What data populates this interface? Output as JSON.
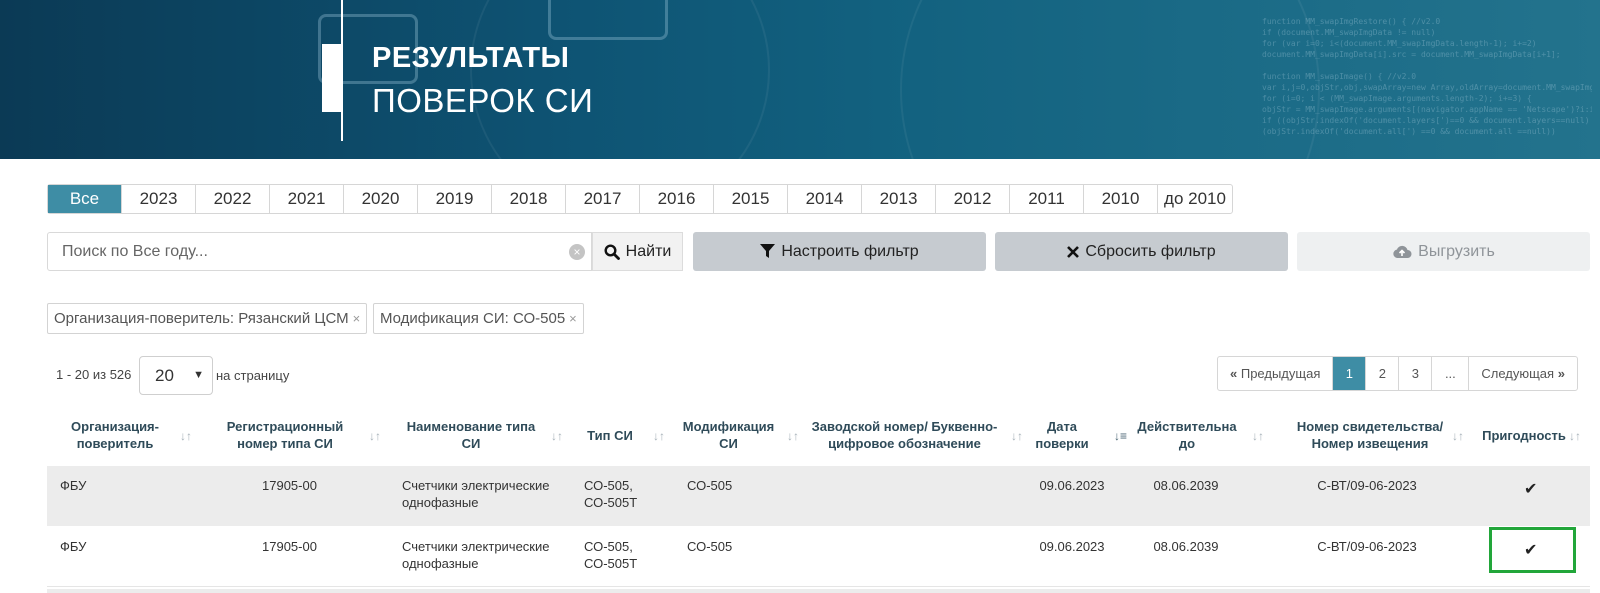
{
  "banner": {
    "title_line1": "РЕЗУЛЬТАТЫ",
    "title_line2": "ПОВЕРОК СИ",
    "code_lines": [
      "function MM_swapImgRestore() { //v2.0",
      "if (document.MM_swapImgData != null)",
      "for (var i=0; i<(document.MM_swapImgData.length-1); i+=2)",
      "document.MM_swapImgData[i].src = document.MM_swapImgData[i+1];",
      "",
      "function MM_swapImage() { //v2.0",
      "var i,j=0,objStr,obj,swapArray=new Array,oldArray=document.MM_swapImgData;",
      "for (i=0; i < (MM_swapImage.arguments.length-2); i+=3) {",
      "objStr = MM_swapImage.arguments[(navigator.appName == 'Netscape')?i:i+1];",
      "if ((objStr.indexOf('document.layers[')==0 && document.layers==null) ||",
      "(objStr.indexOf('document.all[') ==0 && document.all ==null))"
    ]
  },
  "years": {
    "active": "Все",
    "items": [
      "Все",
      "2023",
      "2022",
      "2021",
      "2020",
      "2019",
      "2018",
      "2017",
      "2016",
      "2015",
      "2014",
      "2013",
      "2012",
      "2011",
      "2010",
      "до 2010"
    ]
  },
  "search": {
    "placeholder": "Поиск по Все году...",
    "clear_glyph": "×",
    "find_label": "Найти"
  },
  "buttons": {
    "filter": "Настроить фильтр",
    "reset": "Сбросить фильтр",
    "export": "Выгрузить"
  },
  "chips": [
    {
      "label": "Организация-поверитель: Рязанский ЦСМ",
      "remove": "×"
    },
    {
      "label": "Модификация СИ: СО-505",
      "remove": "×"
    }
  ],
  "paging": {
    "count": "1 - 20 из 526",
    "per_page": "20",
    "per_page_label": "на страницу",
    "prev": "Предыдущая",
    "pages": [
      "1",
      "2",
      "3",
      "..."
    ],
    "active_page": "1",
    "next": "Следующая"
  },
  "table": {
    "headers": [
      "Организация-поверитель",
      "Регистрационный номер типа СИ",
      "Наименование типа СИ",
      "Тип СИ",
      "Модификация СИ",
      "Заводской номер/ Буквенно-цифровое обозначение",
      "Дата поверки",
      "Действительна до",
      "Номер свидетельства/ Номер извещения",
      "Пригодность"
    ],
    "rows": [
      {
        "org": "ФБУ",
        "reg": "17905-00",
        "name": "Счетчики электрические однофазные",
        "type": "СО-505, СО-505Т",
        "mod": "СО-505",
        "serial": "",
        "date": "09.06.2023",
        "valid": "08.06.2039",
        "cert": "С-ВТ/09-06-2023",
        "fit": "✔"
      },
      {
        "org": "ФБУ",
        "reg": "17905-00",
        "name": "Счетчики электрические однофазные",
        "type": "СО-505, СО-505Т",
        "mod": "СО-505",
        "serial": "",
        "date": "09.06.2023",
        "valid": "08.06.2039",
        "cert": "С-ВТ/09-06-2023",
        "fit": "✔"
      }
    ]
  },
  "colors": {
    "accent": "#3e8da5",
    "highlight": "#22a63a",
    "banner": "#0e5373"
  }
}
